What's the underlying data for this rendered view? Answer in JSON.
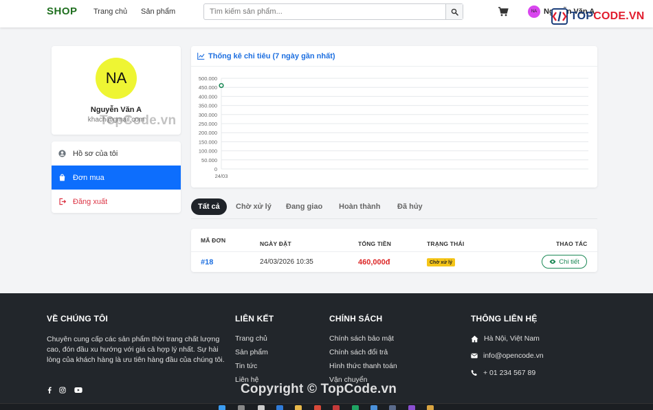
{
  "header": {
    "logo": "SHOP",
    "nav": [
      "Trang chủ",
      "Sản phẩm"
    ],
    "search_placeholder": "Tìm kiếm sản phẩm...",
    "avatar_initials": "NA",
    "user_name": "Nguyễn Văn A",
    "brand": "TOPCODE.VN",
    "brand_main": "TOP",
    "brand_accent": "CODE.VN"
  },
  "profile": {
    "initials": "NA",
    "name": "Nguyễn Văn A",
    "email": "khach@gmail.com",
    "watermark": "TopCode.vn"
  },
  "menu": {
    "items": [
      {
        "label": "Hồ sơ của tôi",
        "icon": "user-circle-icon"
      },
      {
        "label": "Đơn mua",
        "icon": "shopping-bag-icon"
      },
      {
        "label": "Đăng xuất",
        "icon": "logout-icon"
      }
    ]
  },
  "chart": {
    "title": "Thống kê chi tiêu (7 ngày gần nhất)"
  },
  "chart_data": {
    "type": "line",
    "title": "Thống kê chi tiêu (7 ngày gần nhất)",
    "categories": [
      "24/03"
    ],
    "series": [
      {
        "values": [
          460000
        ]
      }
    ],
    "ylim": [
      0,
      500000
    ],
    "yticks": [
      0,
      50000,
      100000,
      150000,
      200000,
      250000,
      300000,
      350000,
      400000,
      450000,
      500000
    ],
    "ytick_labels": [
      "0",
      "50.000",
      "100.000",
      "150.000",
      "200.000",
      "250.000",
      "300.000",
      "350.000",
      "400.000",
      "450.000",
      "500.000"
    ],
    "grid": true,
    "legend": "none",
    "color": "#198754"
  },
  "tabs": [
    "Tất cả",
    "Chờ xử lý",
    "Đang giao",
    "Hoàn thành",
    "Đã hủy"
  ],
  "orders": {
    "headers": {
      "id": "MÃ ĐƠN",
      "date": "NGÀY ĐẶT",
      "total": "TỔNG TIỀN",
      "status": "TRẠNG THÁI",
      "action": "THAO TÁC"
    },
    "rows": [
      {
        "id": "#18",
        "date": "24/03/2026 10:35",
        "total": "460,000đ",
        "status": "Chờ xử lý",
        "action": "Chi tiết"
      }
    ]
  },
  "footer": {
    "about_title": "VỀ CHÚNG TÔI",
    "about_text": "Chuyên cung cấp các sản phẩm thời trang chất lượng cao, đón đầu xu hướng với giá cả hợp lý nhất. Sự hài lòng của khách hàng là ưu tiên hàng đầu của chúng tôi.",
    "links_title": "LIÊN KẾT",
    "links": [
      "Trang chủ",
      "Sản phẩm",
      "Tin tức",
      "Liên hệ"
    ],
    "policy_title": "CHÍNH SÁCH",
    "policies": [
      "Chính sách bảo mật",
      "Chính sách đổi trả",
      "Hình thức thanh toán",
      "Vận chuyển"
    ],
    "contact_title": "THÔNG LIÊN HỆ",
    "address": "Hà Nội, Việt Nam",
    "email": "info@opencode.vn",
    "phone": "+ 01 234 567 89",
    "copyright": "Copyright © TopCode.vn"
  },
  "colors": {
    "primary": "#0d6efd",
    "logo_green": "#1f6f1f",
    "danger": "#dc3545",
    "badge_yellow": "#f5c518",
    "footer_bg": "#22262b"
  }
}
